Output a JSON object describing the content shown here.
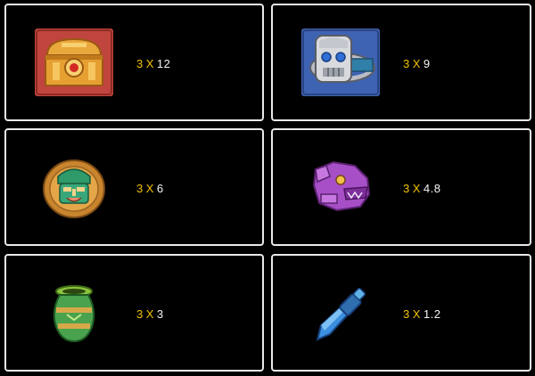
{
  "paytable": [
    {
      "symbol_icon": "treasure-chest-icon",
      "count": "3",
      "times": "X",
      "multiplier": "12"
    },
    {
      "symbol_icon": "jade-ring-icon",
      "count": "3",
      "times": "X",
      "multiplier": "9"
    },
    {
      "symbol_icon": "golden-mask-coin-icon",
      "count": "3",
      "times": "X",
      "multiplier": "6"
    },
    {
      "symbol_icon": "purple-jaguar-head-icon",
      "count": "3",
      "times": "X",
      "multiplier": "4.8"
    },
    {
      "symbol_icon": "green-vase-icon",
      "count": "3",
      "times": "X",
      "multiplier": "3"
    },
    {
      "symbol_icon": "blue-dagger-icon",
      "count": "3",
      "times": "X",
      "multiplier": "1.2"
    }
  ],
  "colors": {
    "background": "#000000",
    "border": "#e9e9e9",
    "accent": "#f2c200",
    "text": "#f5f5f5"
  }
}
